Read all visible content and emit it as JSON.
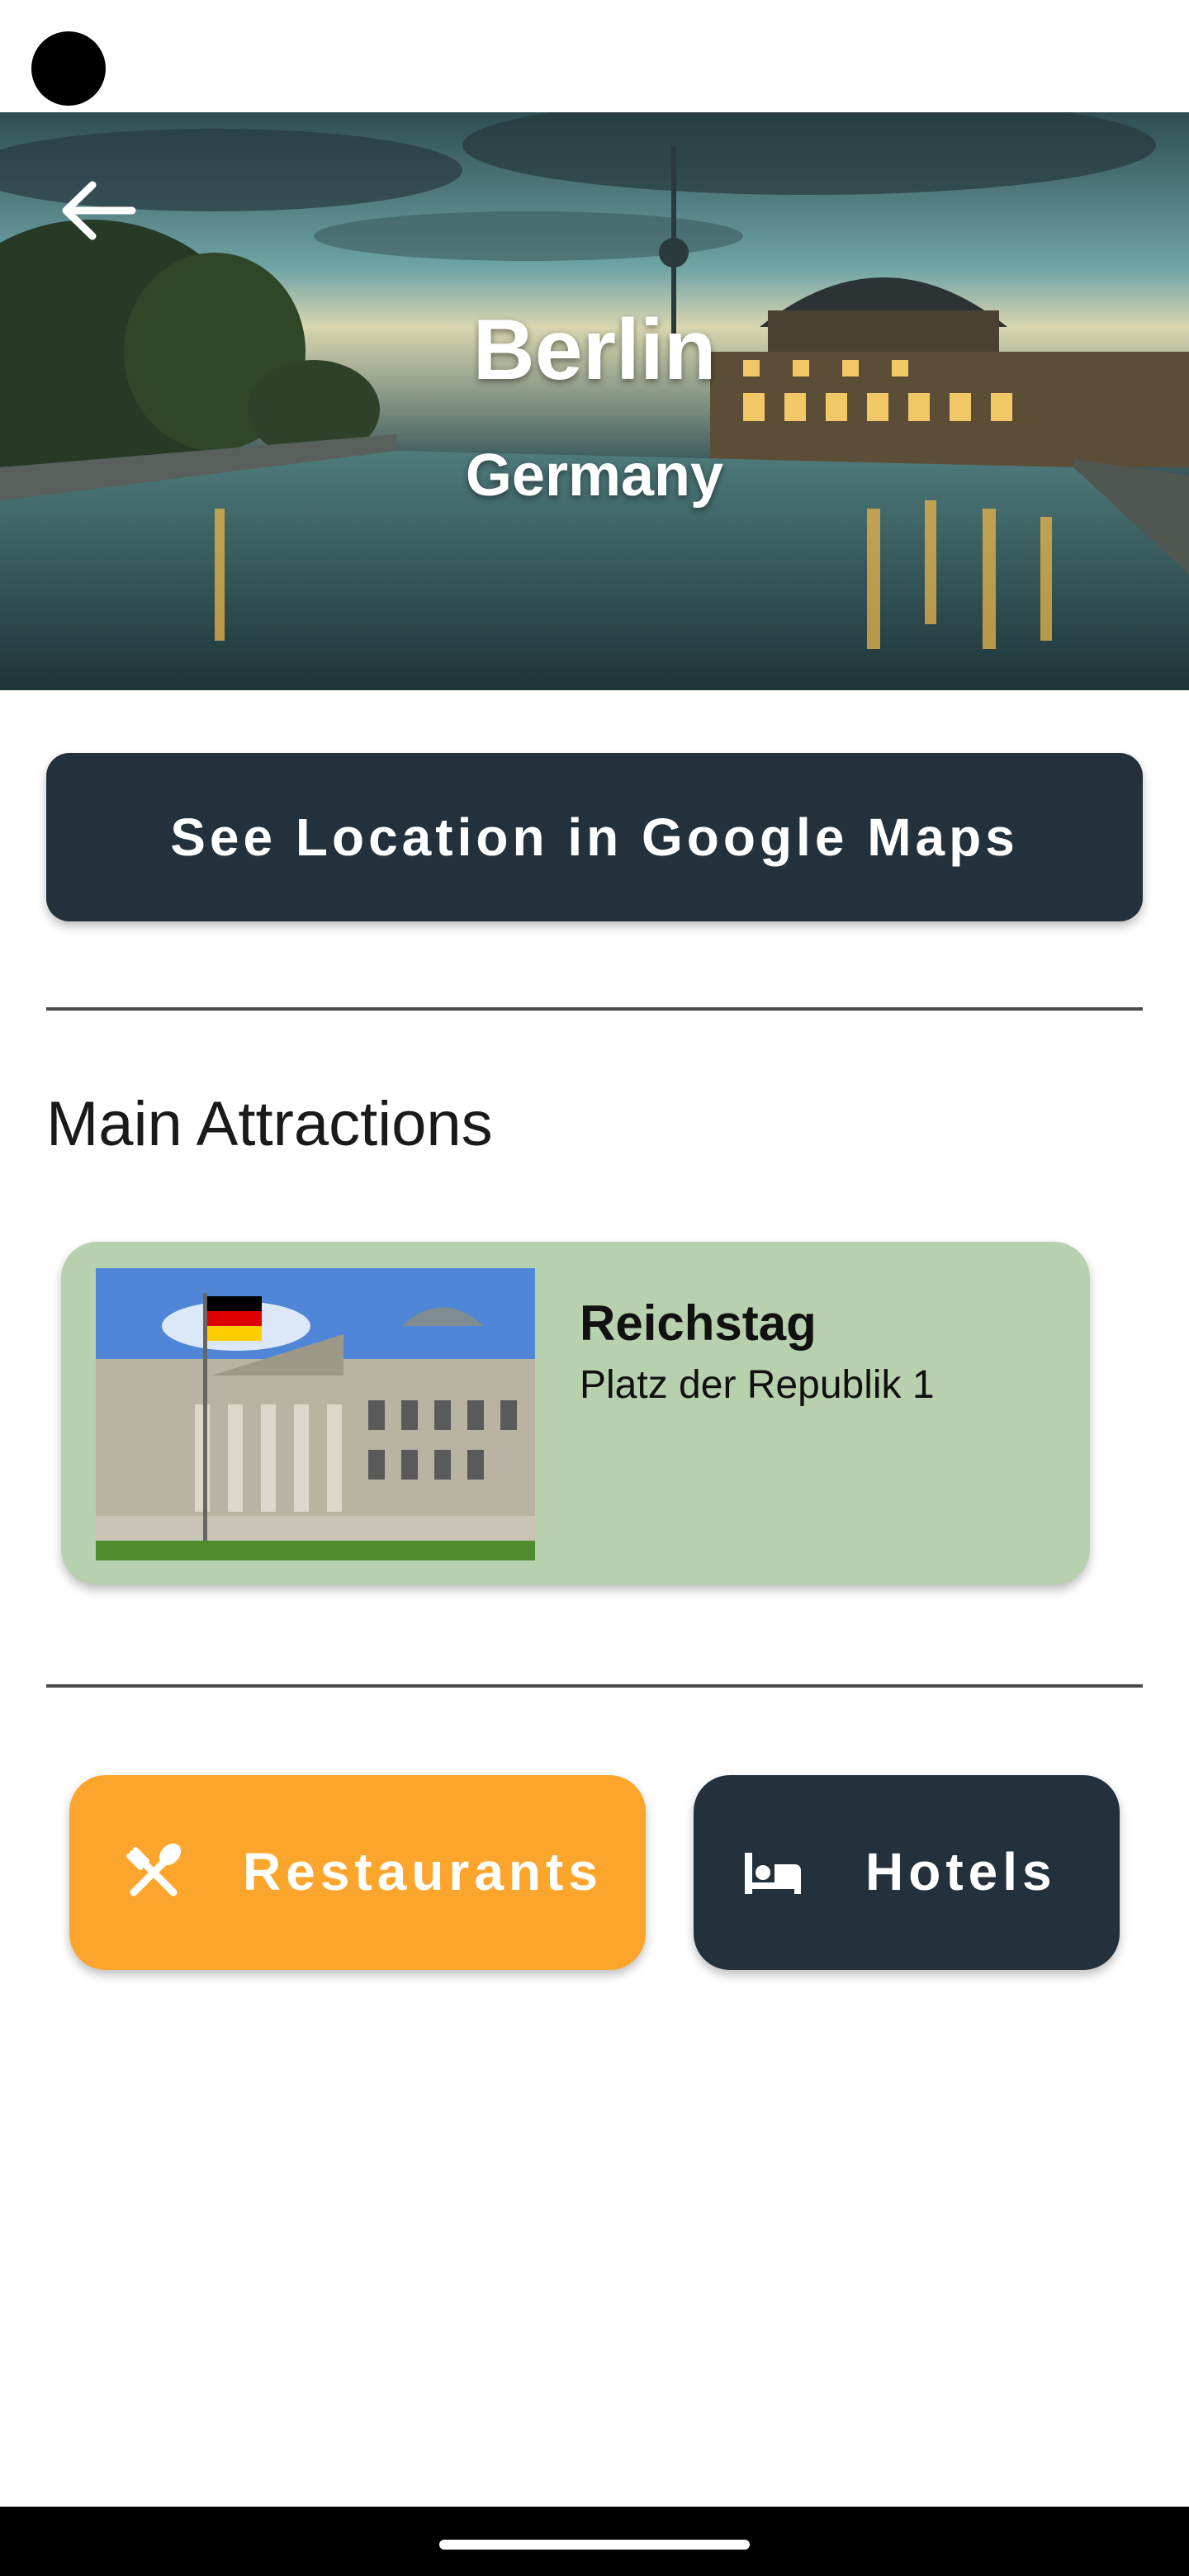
{
  "hero": {
    "title": "Berlin",
    "subtitle": "Germany",
    "back_icon": "arrow-left-icon"
  },
  "maps_button": {
    "label": "See Location in Google Maps"
  },
  "attractions": {
    "heading": "Main Attractions",
    "items": [
      {
        "name": "Reichstag",
        "address": "Platz der Republik 1"
      }
    ]
  },
  "actions": {
    "restaurants": {
      "label": "Restaurants",
      "icon": "restaurant-icon"
    },
    "hotels": {
      "label": "Hotels",
      "icon": "bed-icon"
    }
  },
  "colors": {
    "dark": "#22313b",
    "orange": "#fba52d",
    "card_green": "#b7d0ad"
  }
}
